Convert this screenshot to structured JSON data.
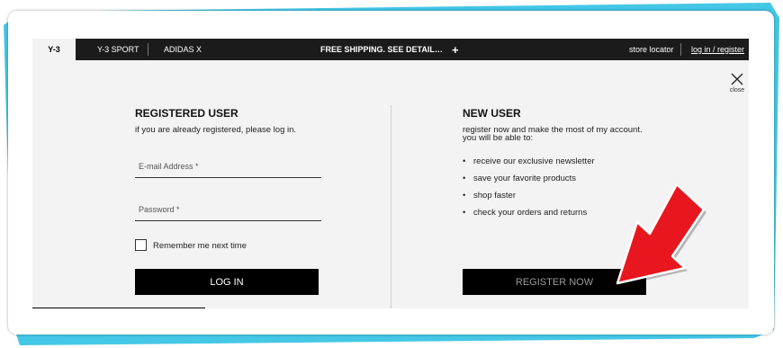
{
  "colors": {
    "accent": "#45c7e6",
    "arrow": "#e8171f",
    "nav": "#1b1b1b",
    "panel": "#f3f3f3"
  },
  "nav": {
    "brand": "Y-3",
    "items": [
      "Y-3 SPORT",
      "ADIDAS X"
    ],
    "promo": "FREE SHIPPING. SEE DETAIL…",
    "plus": "+",
    "store": "store locator",
    "login": "log in / register"
  },
  "close": {
    "icon": "close-icon",
    "label": "close"
  },
  "registered": {
    "title": "REGISTERED USER",
    "desc": "if you are already registered, please log in.",
    "email_label": "E-mail Address *",
    "password_label": "Password *",
    "remember": "Remember me next time",
    "button": "LOG IN"
  },
  "new_user": {
    "title": "NEW USER",
    "desc1": "register now and make the most of my account.",
    "desc2": "you will be able to:",
    "bullets": [
      "receive our exclusive newsletter",
      "save your favorite products",
      "shop faster",
      "check your orders and returns"
    ],
    "button": "REGISTER NOW"
  }
}
